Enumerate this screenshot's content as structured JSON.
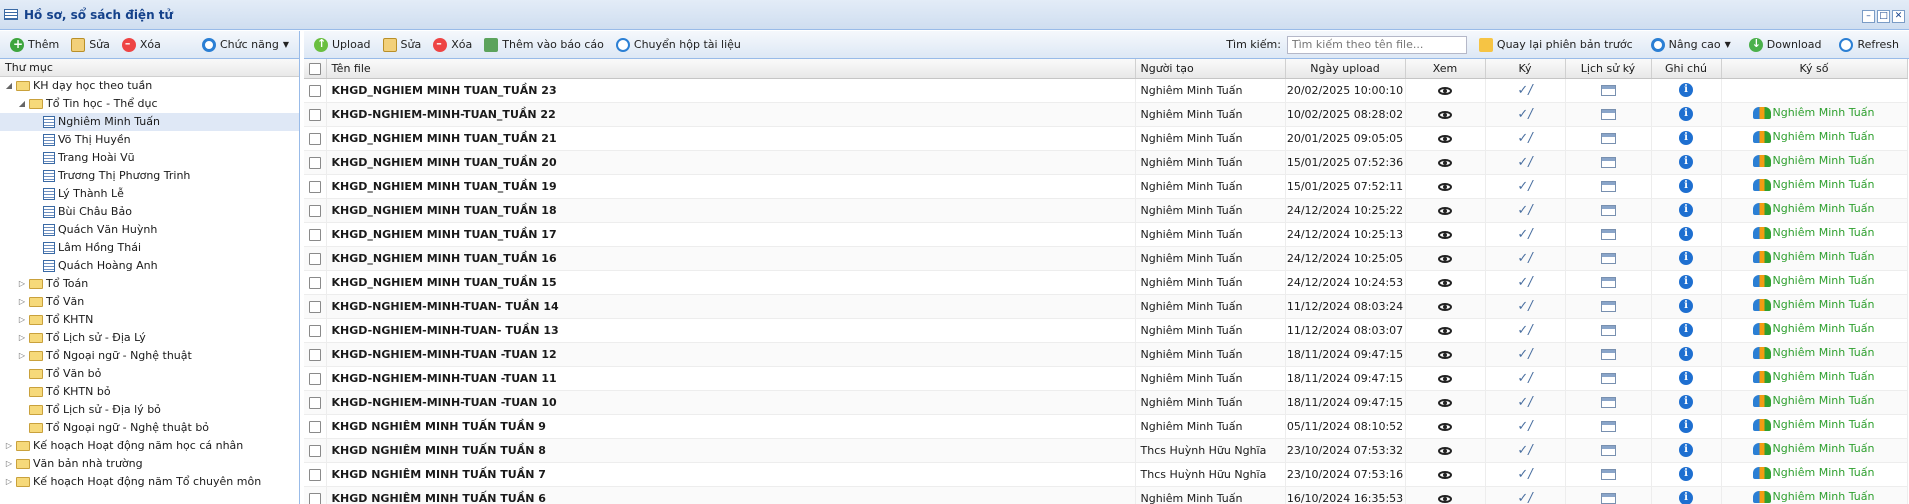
{
  "window": {
    "title": "Hồ sơ, sổ sách điện tử"
  },
  "left_toolbar": {
    "add_label": "Thêm",
    "edit_label": "Sửa",
    "delete_label": "Xóa",
    "function_label": "Chức năng"
  },
  "tree": {
    "header": "Thư mục",
    "nodes": [
      {
        "label": "KH dạy học theo tuần",
        "type": "folder",
        "expand": "open"
      },
      {
        "label": "Tổ Tin học - Thể dục",
        "type": "folder",
        "expand": "open"
      },
      {
        "label": "Nghiêm Minh Tuấn",
        "type": "file",
        "expand": ""
      },
      {
        "label": "Võ Thị Huyền",
        "type": "file",
        "expand": ""
      },
      {
        "label": "Trang Hoài Vũ",
        "type": "file",
        "expand": ""
      },
      {
        "label": "Trương Thị Phương Trinh",
        "type": "file",
        "expand": ""
      },
      {
        "label": "Lý Thành Lễ",
        "type": "file",
        "expand": ""
      },
      {
        "label": "Bùi Châu Bảo",
        "type": "file",
        "expand": ""
      },
      {
        "label": "Quách Văn Huỳnh",
        "type": "file",
        "expand": ""
      },
      {
        "label": "Lâm Hồng Thái",
        "type": "file",
        "expand": ""
      },
      {
        "label": "Quách Hoàng Anh",
        "type": "file",
        "expand": ""
      },
      {
        "label": "Tổ Toán",
        "type": "folder",
        "expand": "closed"
      },
      {
        "label": "Tổ Văn",
        "type": "folder",
        "expand": "closed"
      },
      {
        "label": "Tổ KHTN",
        "type": "folder",
        "expand": "closed"
      },
      {
        "label": "Tổ Lịch sử - Địa Lý",
        "type": "folder",
        "expand": "closed"
      },
      {
        "label": "Tổ Ngoại ngữ - Nghệ thuật",
        "type": "folder",
        "expand": "closed"
      },
      {
        "label": "Tổ Văn bỏ",
        "type": "folder",
        "expand": ""
      },
      {
        "label": "Tổ KHTN bỏ",
        "type": "folder",
        "expand": ""
      },
      {
        "label": "Tổ Lịch sử - Địa lý bỏ",
        "type": "folder",
        "expand": ""
      },
      {
        "label": "Tổ Ngoại ngữ - Nghệ thuật bỏ",
        "type": "folder",
        "expand": ""
      },
      {
        "label": "Kế hoạch Hoạt động năm học cá nhân",
        "type": "folder",
        "expand": "closed"
      },
      {
        "label": "Văn bản nhà trường",
        "type": "folder",
        "expand": "closed"
      },
      {
        "label": "Kế hoạch Hoạt động năm Tổ chuyên môn",
        "type": "folder",
        "expand": "closed"
      }
    ],
    "selected": "Nghiêm Minh Tuấn"
  },
  "right_toolbar": {
    "upload_label": "Upload",
    "edit_label": "Sửa",
    "delete_label": "Xóa",
    "add_report_label": "Thêm vào báo cáo",
    "move_label": "Chuyển hộp tài liệu",
    "search_label": "Tìm kiếm:",
    "search_placeholder": "Tìm kiếm theo tên file...",
    "restore_label": "Quay lại phiên bản trước",
    "advanced_label": "Nâng cao",
    "download_label": "Download",
    "refresh_label": "Refresh"
  },
  "grid": {
    "columns": [
      "Tên file",
      "Người tạo",
      "Ngày upload",
      "Xem",
      "Ký",
      "Lịch sử ký",
      "Ghi chú",
      "Ký số"
    ],
    "rows": [
      {
        "name": "KHGD_NGHIEM MINH TUAN_TUẦN 23",
        "creator": "Nghiêm Minh Tuấn",
        "date": "20/02/2025 10:00:10",
        "signer": ""
      },
      {
        "name": "KHGD-NGHIEM-MINH-TUAN_TUẦN 22",
        "creator": "Nghiêm Minh Tuấn",
        "date": "10/02/2025 08:28:02",
        "signer": "Nghiêm Minh Tuấn"
      },
      {
        "name": "KHGD_NGHIEM MINH TUAN_TUẦN 21",
        "creator": "Nghiêm Minh Tuấn",
        "date": "20/01/2025 09:05:05",
        "signer": "Nghiêm Minh Tuấn"
      },
      {
        "name": "KHGD_NGHIEM MINH TUAN_TUẦN 20",
        "creator": "Nghiêm Minh Tuấn",
        "date": "15/01/2025 07:52:36",
        "signer": "Nghiêm Minh Tuấn"
      },
      {
        "name": "KHGD_NGHIEM MINH TUAN_TUẦN 19",
        "creator": "Nghiêm Minh Tuấn",
        "date": "15/01/2025 07:52:11",
        "signer": "Nghiêm Minh Tuấn"
      },
      {
        "name": "KHGD_NGHIEM MINH TUAN_TUẦN 18",
        "creator": "Nghiêm Minh Tuấn",
        "date": "24/12/2024 10:25:22",
        "signer": "Nghiêm Minh Tuấn"
      },
      {
        "name": "KHGD_NGHIEM MINH TUAN_TUẦN 17",
        "creator": "Nghiêm Minh Tuấn",
        "date": "24/12/2024 10:25:13",
        "signer": "Nghiêm Minh Tuấn"
      },
      {
        "name": "KHGD_NGHIEM MINH TUAN_TUẦN 16",
        "creator": "Nghiêm Minh Tuấn",
        "date": "24/12/2024 10:25:05",
        "signer": "Nghiêm Minh Tuấn"
      },
      {
        "name": "KHGD_NGHIEM MINH TUAN_TUẦN 15",
        "creator": "Nghiêm Minh Tuấn",
        "date": "24/12/2024 10:24:53",
        "signer": "Nghiêm Minh Tuấn"
      },
      {
        "name": "KHGD-NGHIEM-MINH-TUAN- TUẦN 14",
        "creator": "Nghiêm Minh Tuấn",
        "date": "11/12/2024 08:03:24",
        "signer": "Nghiêm Minh Tuấn"
      },
      {
        "name": "KHGD-NGHIEM-MINH-TUAN- TUẦN 13",
        "creator": "Nghiêm Minh Tuấn",
        "date": "11/12/2024 08:03:07",
        "signer": "Nghiêm Minh Tuấn"
      },
      {
        "name": "KHGD-NGHIEM-MINH-TUAN -TUAN 12",
        "creator": "Nghiêm Minh Tuấn",
        "date": "18/11/2024 09:47:15",
        "signer": "Nghiêm Minh Tuấn"
      },
      {
        "name": "KHGD-NGHIEM-MINH-TUAN -TUAN 11",
        "creator": "Nghiêm Minh Tuấn",
        "date": "18/11/2024 09:47:15",
        "signer": "Nghiêm Minh Tuấn"
      },
      {
        "name": "KHGD-NGHIEM-MINH-TUAN -TUAN 10",
        "creator": "Nghiêm Minh Tuấn",
        "date": "18/11/2024 09:47:15",
        "signer": "Nghiêm Minh Tuấn"
      },
      {
        "name": "KHGD NGHIÊM MINH TUẤN TUẦN 9",
        "creator": "Nghiêm Minh Tuấn",
        "date": "05/11/2024 08:10:52",
        "signer": "Nghiêm Minh Tuấn"
      },
      {
        "name": "KHGD NGHIÊM MINH TUẤN TUẦN 8",
        "creator": "Thcs Huỳnh Hữu Nghĩa",
        "date": "23/10/2024 07:53:32",
        "signer": "Nghiêm Minh Tuấn"
      },
      {
        "name": "KHGD NGHIÊM MINH TUẤN TUẦN 7",
        "creator": "Thcs Huỳnh Hữu Nghĩa",
        "date": "23/10/2024 07:53:16",
        "signer": "Nghiêm Minh Tuấn"
      },
      {
        "name": "KHGD NGHIÊM MINH TUẤN TUẦN 6",
        "creator": "Nghiêm Minh Tuấn",
        "date": "16/10/2024 16:35:53",
        "signer": "Nghiêm Minh Tuấn"
      }
    ]
  }
}
